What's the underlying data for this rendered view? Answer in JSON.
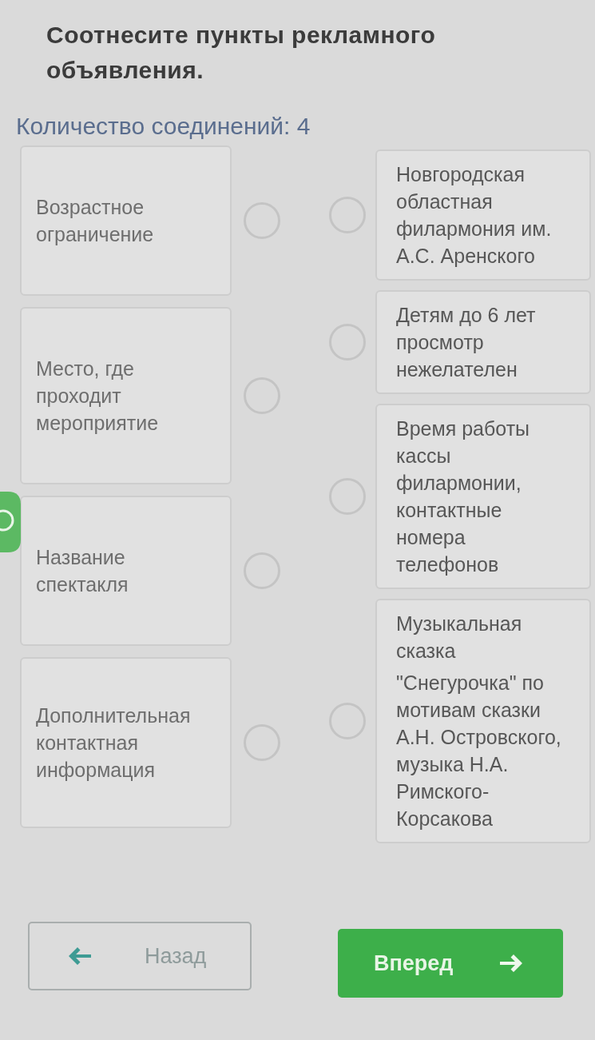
{
  "instruction": "Соотнесите пункты рекламного объявления.",
  "connections_label": "Количество соединений: 4",
  "left_items": [
    {
      "text": "Возрастное ограничение"
    },
    {
      "text": "Место, где проходит мероприятие"
    },
    {
      "text": "Название спектакля"
    },
    {
      "text": "Дополнительная контактная информация"
    }
  ],
  "right_items": [
    {
      "paragraphs": [
        "Новгородская областная филармония им. А.С. Аренского"
      ]
    },
    {
      "paragraphs": [
        "Детям до 6 лет просмотр нежелателен"
      ]
    },
    {
      "paragraphs": [
        "Время работы кассы филармонии, контактные номера телефонов"
      ]
    },
    {
      "paragraphs": [
        "Музыкальная сказка",
        "\"Снегурочка\" по мотивам сказки А.Н. Островского, музыка Н.А. Римского-Корсакова"
      ]
    }
  ],
  "buttons": [
    {
      "kind": "back",
      "label": "Назад"
    },
    {
      "kind": "next",
      "label": "Вперед"
    }
  ]
}
